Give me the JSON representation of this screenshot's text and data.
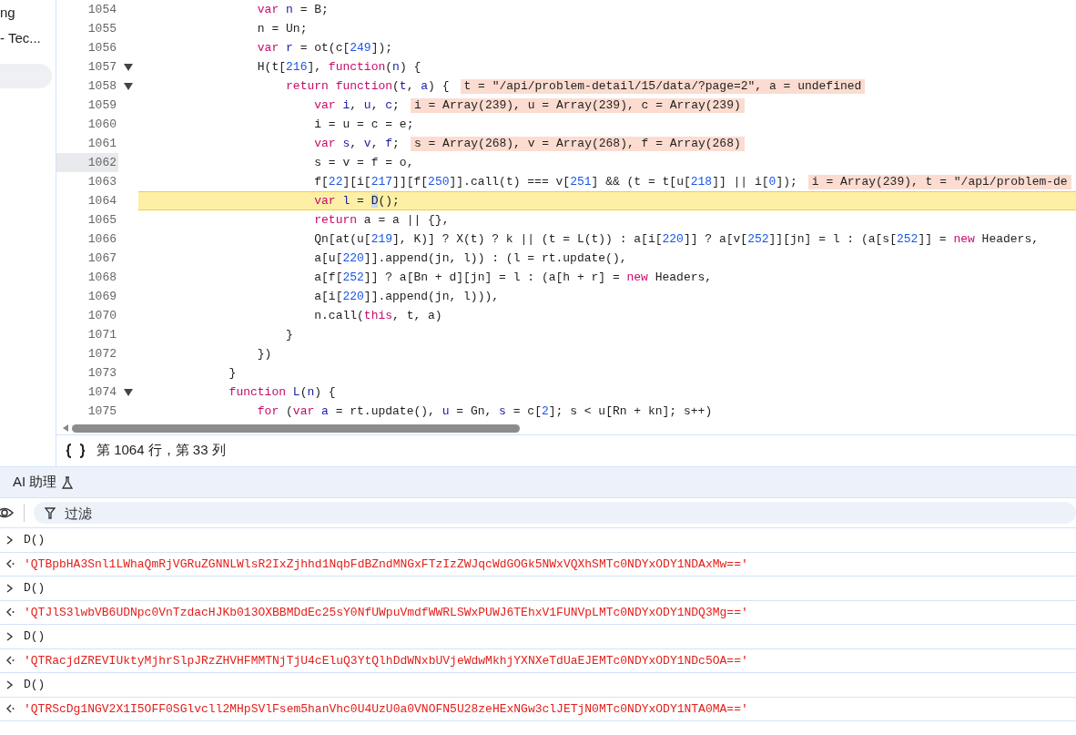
{
  "sidebar": {
    "items": [
      {
        "label": "ng",
        "selected": false
      },
      {
        "label": "- Tec...",
        "selected": false
      },
      {
        "selected": true
      }
    ]
  },
  "editor": {
    "lines": [
      {
        "number": "1054",
        "fold": false,
        "current": false,
        "marker": false,
        "tokens": [
          {
            "kind": "kw",
            "t": "                var"
          },
          {
            "kind": "v",
            "t": " n"
          },
          {
            "kind": "p",
            "t": " = B;"
          }
        ]
      },
      {
        "number": "1055",
        "fold": false,
        "current": false,
        "marker": false,
        "tokens": [
          {
            "kind": "p",
            "t": "                n = Un;"
          }
        ]
      },
      {
        "number": "1056",
        "fold": false,
        "current": false,
        "marker": false,
        "tokens": [
          {
            "kind": "kw",
            "t": "                var"
          },
          {
            "kind": "v",
            "t": " r"
          },
          {
            "kind": "p",
            "t": " = ot(c["
          },
          {
            "kind": "n",
            "t": "249"
          },
          {
            "kind": "p",
            "t": "]);"
          }
        ]
      },
      {
        "number": "1057",
        "fold": true,
        "current": false,
        "marker": false,
        "tokens": [
          {
            "kind": "p",
            "t": "                H(t["
          },
          {
            "kind": "n",
            "t": "216"
          },
          {
            "kind": "p",
            "t": "], "
          },
          {
            "kind": "kw",
            "t": "function"
          },
          {
            "kind": "p",
            "t": "("
          },
          {
            "kind": "v",
            "t": "n"
          },
          {
            "kind": "p",
            "t": ") {"
          }
        ]
      },
      {
        "number": "1058",
        "fold": true,
        "current": false,
        "marker": false,
        "tokens": [
          {
            "kind": "kw",
            "t": "                    return function"
          },
          {
            "kind": "p",
            "t": "("
          },
          {
            "kind": "v",
            "t": "t"
          },
          {
            "kind": "p",
            "t": ", "
          },
          {
            "kind": "v",
            "t": "a"
          },
          {
            "kind": "p",
            "t": ") {"
          }
        ],
        "inline_value": "t = \"/api/problem-detail/15/data/?page=2\", a = undefined"
      },
      {
        "number": "1059",
        "fold": false,
        "current": false,
        "marker": false,
        "tokens": [
          {
            "kind": "kw",
            "t": "                        var"
          },
          {
            "kind": "v",
            "t": " i"
          },
          {
            "kind": "p",
            "t": ", "
          },
          {
            "kind": "v",
            "t": "u"
          },
          {
            "kind": "p",
            "t": ", "
          },
          {
            "kind": "v",
            "t": "c"
          },
          {
            "kind": "p",
            "t": ";"
          }
        ],
        "inline_value": "i = Array(239), u = Array(239), c = Array(239)"
      },
      {
        "number": "1060",
        "fold": false,
        "current": false,
        "marker": false,
        "tokens": [
          {
            "kind": "p",
            "t": "                        i = u = c = e;"
          }
        ]
      },
      {
        "number": "1061",
        "fold": false,
        "current": false,
        "marker": false,
        "tokens": [
          {
            "kind": "kw",
            "t": "                        var"
          },
          {
            "kind": "v",
            "t": " s"
          },
          {
            "kind": "p",
            "t": ", "
          },
          {
            "kind": "v",
            "t": "v"
          },
          {
            "kind": "p",
            "t": ", "
          },
          {
            "kind": "v",
            "t": "f"
          },
          {
            "kind": "p",
            "t": ";"
          }
        ],
        "inline_value": "s = Array(268), v = Array(268), f = Array(268)"
      },
      {
        "number": "1062",
        "fold": false,
        "current": false,
        "marker": true,
        "tokens": [
          {
            "kind": "p",
            "t": "                        s = v = f = o,"
          }
        ]
      },
      {
        "number": "1063",
        "fold": false,
        "current": false,
        "marker": false,
        "tokens": [
          {
            "kind": "p",
            "t": "                        f["
          },
          {
            "kind": "n",
            "t": "22"
          },
          {
            "kind": "p",
            "t": "][i["
          },
          {
            "kind": "n",
            "t": "217"
          },
          {
            "kind": "p",
            "t": "]][f["
          },
          {
            "kind": "n",
            "t": "250"
          },
          {
            "kind": "p",
            "t": "]].call(t) === v["
          },
          {
            "kind": "n",
            "t": "251"
          },
          {
            "kind": "p",
            "t": "] && (t = t[u["
          },
          {
            "kind": "n",
            "t": "218"
          },
          {
            "kind": "p",
            "t": "]] || i["
          },
          {
            "kind": "n",
            "t": "0"
          },
          {
            "kind": "p",
            "t": "]);"
          }
        ],
        "inline_value": "i = Array(239), t = \"/api/problem-de"
      },
      {
        "number": "1064",
        "fold": false,
        "current": true,
        "marker": false,
        "tokens": [
          {
            "kind": "kw",
            "t": "                        var"
          },
          {
            "kind": "v",
            "t": " l"
          },
          {
            "kind": "p",
            "t": " = "
          },
          {
            "kind": "sel",
            "t": "D"
          },
          {
            "kind": "p",
            "t": "();"
          }
        ]
      },
      {
        "number": "1065",
        "fold": false,
        "current": false,
        "marker": false,
        "tokens": [
          {
            "kind": "kw",
            "t": "                        return"
          },
          {
            "kind": "p",
            "t": " a = a || {},"
          }
        ]
      },
      {
        "number": "1066",
        "fold": false,
        "current": false,
        "marker": false,
        "tokens": [
          {
            "kind": "p",
            "t": "                        Qn[at(u["
          },
          {
            "kind": "n",
            "t": "219"
          },
          {
            "kind": "p",
            "t": "], K)] ? X(t) ? k || (t = L(t)) : a[i["
          },
          {
            "kind": "n",
            "t": "220"
          },
          {
            "kind": "p",
            "t": "]] ? a[v["
          },
          {
            "kind": "n",
            "t": "252"
          },
          {
            "kind": "p",
            "t": "]][jn] = l : (a[s["
          },
          {
            "kind": "n",
            "t": "252"
          },
          {
            "kind": "p",
            "t": "]] = "
          },
          {
            "kind": "kw",
            "t": "new"
          },
          {
            "kind": "p",
            "t": " Headers,"
          }
        ]
      },
      {
        "number": "1067",
        "fold": false,
        "current": false,
        "marker": false,
        "tokens": [
          {
            "kind": "p",
            "t": "                        a[u["
          },
          {
            "kind": "n",
            "t": "220"
          },
          {
            "kind": "p",
            "t": "]].append(jn, l)) : (l = rt.update(),"
          }
        ]
      },
      {
        "number": "1068",
        "fold": false,
        "current": false,
        "marker": false,
        "tokens": [
          {
            "kind": "p",
            "t": "                        a[f["
          },
          {
            "kind": "n",
            "t": "252"
          },
          {
            "kind": "p",
            "t": "]] ? a[Bn + d][jn] = l : (a[h + r] = "
          },
          {
            "kind": "kw",
            "t": "new"
          },
          {
            "kind": "p",
            "t": " Headers,"
          }
        ]
      },
      {
        "number": "1069",
        "fold": false,
        "current": false,
        "marker": false,
        "tokens": [
          {
            "kind": "p",
            "t": "                        a[i["
          },
          {
            "kind": "n",
            "t": "220"
          },
          {
            "kind": "p",
            "t": "]].append(jn, l))),"
          }
        ]
      },
      {
        "number": "1070",
        "fold": false,
        "current": false,
        "marker": false,
        "tokens": [
          {
            "kind": "p",
            "t": "                        n.call("
          },
          {
            "kind": "kw",
            "t": "this"
          },
          {
            "kind": "p",
            "t": ", t, a)"
          }
        ]
      },
      {
        "number": "1071",
        "fold": false,
        "current": false,
        "marker": false,
        "tokens": [
          {
            "kind": "p",
            "t": "                    }"
          }
        ]
      },
      {
        "number": "1072",
        "fold": false,
        "current": false,
        "marker": false,
        "tokens": [
          {
            "kind": "p",
            "t": "                })"
          }
        ]
      },
      {
        "number": "1073",
        "fold": false,
        "current": false,
        "marker": false,
        "tokens": [
          {
            "kind": "p",
            "t": "            }"
          }
        ]
      },
      {
        "number": "1074",
        "fold": true,
        "current": false,
        "marker": false,
        "tokens": [
          {
            "kind": "kw",
            "t": "            function"
          },
          {
            "kind": "v",
            "t": " L"
          },
          {
            "kind": "p",
            "t": "("
          },
          {
            "kind": "v",
            "t": "n"
          },
          {
            "kind": "p",
            "t": ") {"
          }
        ]
      },
      {
        "number": "1075",
        "fold": false,
        "current": false,
        "marker": false,
        "tokens": [
          {
            "kind": "kw",
            "t": "                for"
          },
          {
            "kind": "p",
            "t": " ("
          },
          {
            "kind": "kw",
            "t": "var"
          },
          {
            "kind": "v",
            "t": " a"
          },
          {
            "kind": "p",
            "t": " = rt.update(), "
          },
          {
            "kind": "v",
            "t": "u"
          },
          {
            "kind": "p",
            "t": " = Gn, "
          },
          {
            "kind": "v",
            "t": "s"
          },
          {
            "kind": "p",
            "t": " = c["
          },
          {
            "kind": "n",
            "t": "2"
          },
          {
            "kind": "p",
            "t": "]; s < u[Rn + kn]; s++)"
          }
        ]
      }
    ],
    "status": "第 1064 行，第 33 列"
  },
  "drawer": {
    "tab": "AI 助理"
  },
  "console": {
    "filter_placeholder": "过滤",
    "rows": [
      {
        "kind": "input",
        "text": "D()"
      },
      {
        "kind": "result",
        "text": "'QTBpbHA3Snl1LWhaQmRjVGRuZGNNLWlsR2IxZjhhd1NqbFdBZndMNGxFTzIzZWJqcWdGOGk5NWxVQXhSMTc0NDYxODY1NDAxMw=='"
      },
      {
        "kind": "input",
        "text": "D()"
      },
      {
        "kind": "result",
        "text": "'QTJlS3lwbVB6UDNpc0VnTzdacHJKb013OXBBMDdEc25sY0NfUWpuVmdfWWRLSWxPUWJ6TEhxV1FUNVpLMTc0NDYxODY1NDQ3Mg=='"
      },
      {
        "kind": "input",
        "text": "D()"
      },
      {
        "kind": "result",
        "text": "'QTRacjdZREVIUktyMjhrSlpJRzZHVHFMMTNjTjU4cEluQ3YtQlhDdWNxbUVjeWdwMkhjYXNXeTdUaEJEMTc0NDYxODY1NDc5OA=='"
      },
      {
        "kind": "input",
        "text": "D()"
      },
      {
        "kind": "result",
        "text": "'QTRScDg1NGV2X1I5OFF0SGlvcll2MHpSVlFsem5hanVhc0U4UzU0a0VNOFN5U28zeHExNGw3clJETjN0MTc0NDYxODY1NTA0MA=='"
      }
    ]
  }
}
